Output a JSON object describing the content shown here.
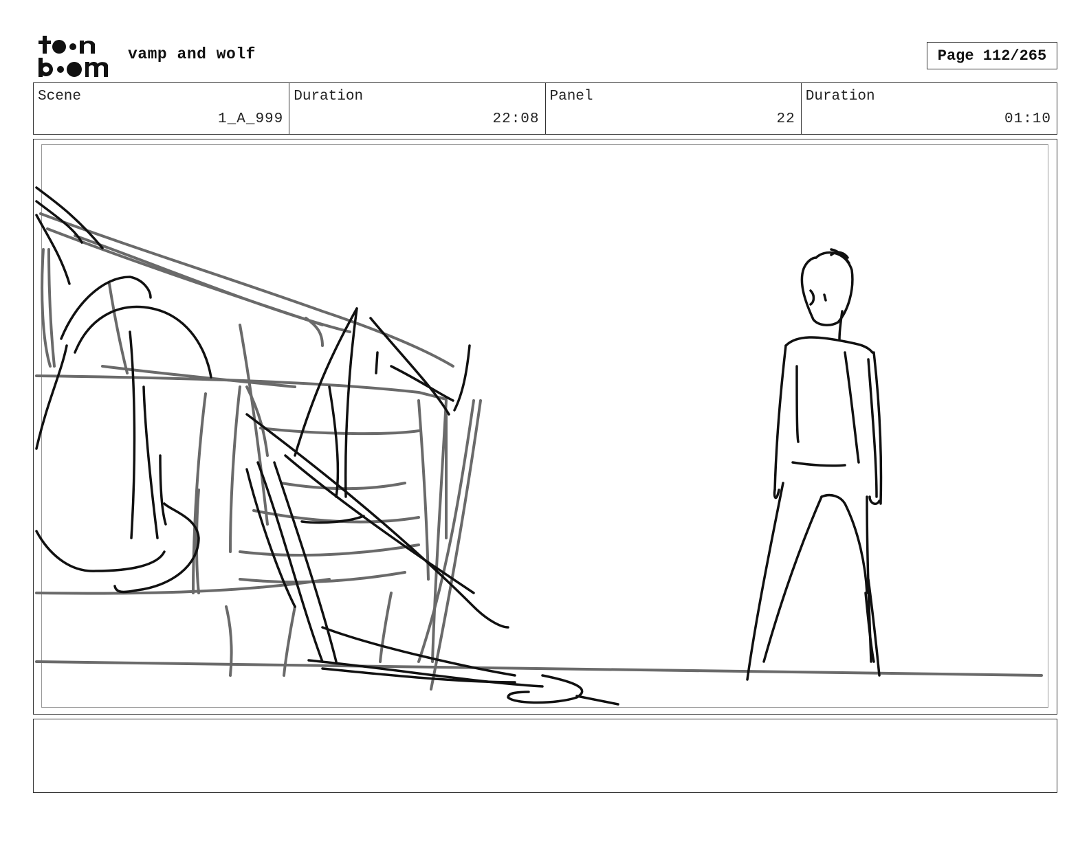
{
  "header": {
    "project_title": "vamp and wolf",
    "page_label": "Page 112/265"
  },
  "info": {
    "scene_label": "Scene",
    "scene_value": "1_A_999",
    "scene_duration_label": "Duration",
    "scene_duration_value": "22:08",
    "panel_label": "Panel",
    "panel_value": "22",
    "panel_duration_label": "Duration",
    "panel_duration_value": "01:10"
  },
  "notes": {
    "text": ""
  }
}
